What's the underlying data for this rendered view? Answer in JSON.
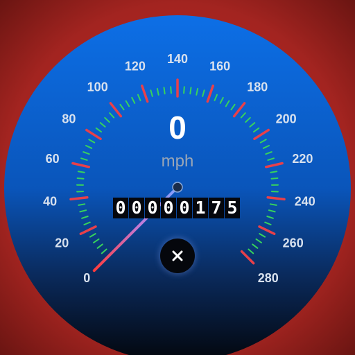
{
  "speedometer": {
    "speed": "0",
    "unit": "mph",
    "min": 0,
    "max": 280,
    "needle_value": 0,
    "major_labels": [
      "0",
      "20",
      "40",
      "60",
      "80",
      "100",
      "120",
      "140",
      "160",
      "180",
      "200",
      "220",
      "240",
      "260",
      "280"
    ],
    "odometer_digits": [
      "0",
      "0",
      "0",
      "0",
      "0",
      "1",
      "7",
      "5"
    ],
    "colors": {
      "major_tick": "#e8404a",
      "minor_tick": "#37d35c",
      "face_top": "#0d6fe6",
      "face_bottom": "#04070d",
      "background": "#a32420"
    }
  },
  "controls": {
    "close_icon": "close-icon"
  }
}
